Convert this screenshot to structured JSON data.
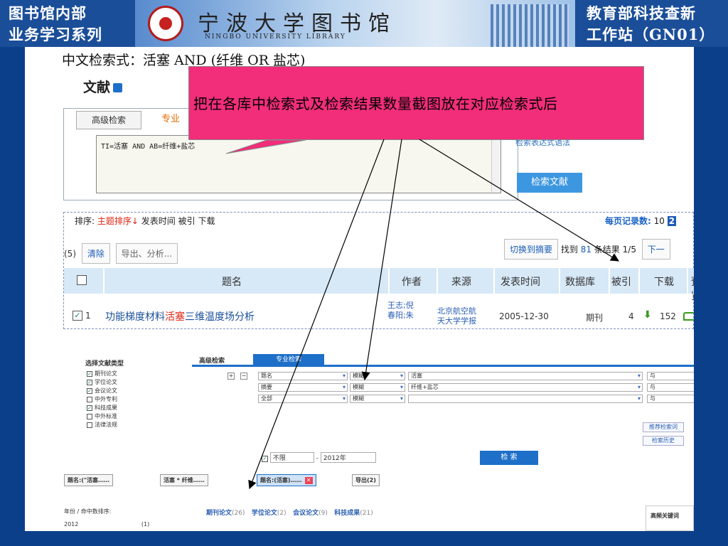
{
  "header": {
    "left_line1": "图书馆内部",
    "left_line2": "业务学习系列",
    "library_name": "宁波大学图书馆",
    "library_name_en": "NINGBO UNIVERSITY LIBRARY",
    "right_line1": "教育部科技查新",
    "right_line2": "工作站（GN01）"
  },
  "query_title": "中文检索式：活塞 AND (纤维 OR 盐芯)",
  "section_title": "文献",
  "search": {
    "tab_advanced": "高级检索",
    "tab_professional": "专业",
    "expression": "TI=活塞 AND AB=纤维+盐芯",
    "grammar_link": "检索表达式语法",
    "search_button": "检索文献"
  },
  "callout_text": "把在各库中检索式及检索结果数量截图放在对应检索式后",
  "results": {
    "sort_label": "排序:",
    "sort_active": "主题排序↓",
    "sort_time": "发表时间",
    "sort_cited": "被引",
    "sort_download": "下载",
    "per_page_label": "每页记录数:",
    "per_page_value": "10",
    "per_page_next": "2",
    "selected_count": "(5)",
    "clear_btn": "清除",
    "export_btn": "导出、分析...",
    "switch_btn": "切换到摘要",
    "found_prefix": "找到",
    "found_count": "81",
    "found_suffix": "条结果",
    "page_info": "1/5",
    "next_page": "下一",
    "columns": [
      "题名",
      "作者",
      "来源",
      "发表时间",
      "数据库",
      "被引",
      "下载",
      "预览"
    ],
    "row": {
      "num": "1",
      "title_before": "功能梯度材料",
      "title_hl": "活塞",
      "title_after": "三维温度场分析",
      "author_line1": "王志;倪",
      "author_line2": "春阳;朱",
      "source_line1": "北京航空航",
      "source_line2": "天大学学报",
      "date": "2005-12-30",
      "db": "期刊",
      "cited": "4",
      "downloads": "152"
    }
  },
  "lower": {
    "type_title": "选择文献类型",
    "types": [
      {
        "label": "期刊论文",
        "checked": true
      },
      {
        "label": "学位论文",
        "checked": true
      },
      {
        "label": "会议论文",
        "checked": true
      },
      {
        "label": "中外专利",
        "checked": false
      },
      {
        "label": "科技成果",
        "checked": true
      },
      {
        "label": "中外标准",
        "checked": false
      },
      {
        "label": "法律法规",
        "checked": false
      }
    ],
    "tab_adv": "高级检索",
    "tab_pro": "专业检索",
    "rows": [
      {
        "field": "题名",
        "match": "模糊",
        "value": "活塞",
        "logic": "与"
      },
      {
        "field": "摘要",
        "match": "模糊",
        "value": "纤维+盐芯",
        "logic": "与"
      },
      {
        "field": "全部",
        "match": "模糊",
        "value": "",
        "logic": "与"
      }
    ],
    "recommend_btn": "推荐检索词",
    "history_btn": "检索历史",
    "year_from": "不限",
    "year_to": "2012年",
    "search_btn": "检 索",
    "crumb1": "题名:(\"活塞……",
    "crumb2": "活塞 * 纤维……",
    "crumb3": "题名:(活塞)……",
    "crumb4": "导出(2)",
    "year_label": "年份 / 命中数排序:",
    "year_first": "2012",
    "year_first_count": "(1)",
    "groups": [
      {
        "label": "期刊论文",
        "n": "(26)"
      },
      {
        "label": "学位论文",
        "n": "(2)"
      },
      {
        "label": "会议论文",
        "n": "(9)"
      },
      {
        "label": "科技成果",
        "n": "(21)"
      }
    ],
    "hot_keywords": "高频关键词"
  }
}
